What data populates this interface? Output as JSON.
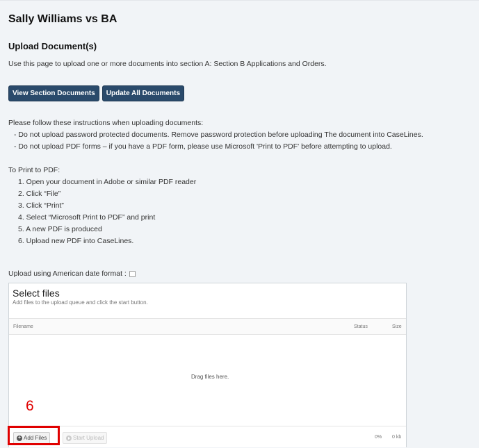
{
  "case": {
    "title": "Sally Williams vs BA"
  },
  "section": {
    "heading": "Upload Document(s)",
    "intro": "Use this page to upload one or more documents into section A: Section B Applications and Orders."
  },
  "buttons": {
    "view_section": "View Section Documents",
    "update_all": "Update All Documents"
  },
  "instructions": {
    "lead": "Please follow these instructions when uploading documents:",
    "items": [
      "- Do not upload password protected documents. Remove password protection before uploading The document into CaseLines.",
      "- Do not upload PDF forms – if you have a PDF form, please use Microsoft 'Print to PDF' before attempting to upload."
    ]
  },
  "print_to_pdf": {
    "heading": "To Print to PDF:",
    "steps": [
      "1. Open your document in Adobe or similar PDF reader",
      "2. Click “File”",
      "3. Click “Print”",
      "4. Select “Microsoft Print to PDF” and print",
      "5. A new PDF is produced",
      "6. Upload new PDF into CaseLines."
    ]
  },
  "date_format": {
    "label": "Upload using American date format :",
    "checked": false
  },
  "uploader": {
    "title": "Select files",
    "subtitle": "Add files to the upload queue and click the start button.",
    "columns": {
      "filename": "Filename",
      "status": "Status",
      "size": "Size"
    },
    "drop_text": "Drag files here.",
    "add_files": "Add Files",
    "start_upload": "Start Upload",
    "progress_percent": "0%",
    "progress_size": "0 kb"
  },
  "annotation": {
    "step": "6",
    "color": "#e00000"
  },
  "colors": {
    "button_bg": "#2a4a6b",
    "page_bg": "#f1f4f7"
  }
}
